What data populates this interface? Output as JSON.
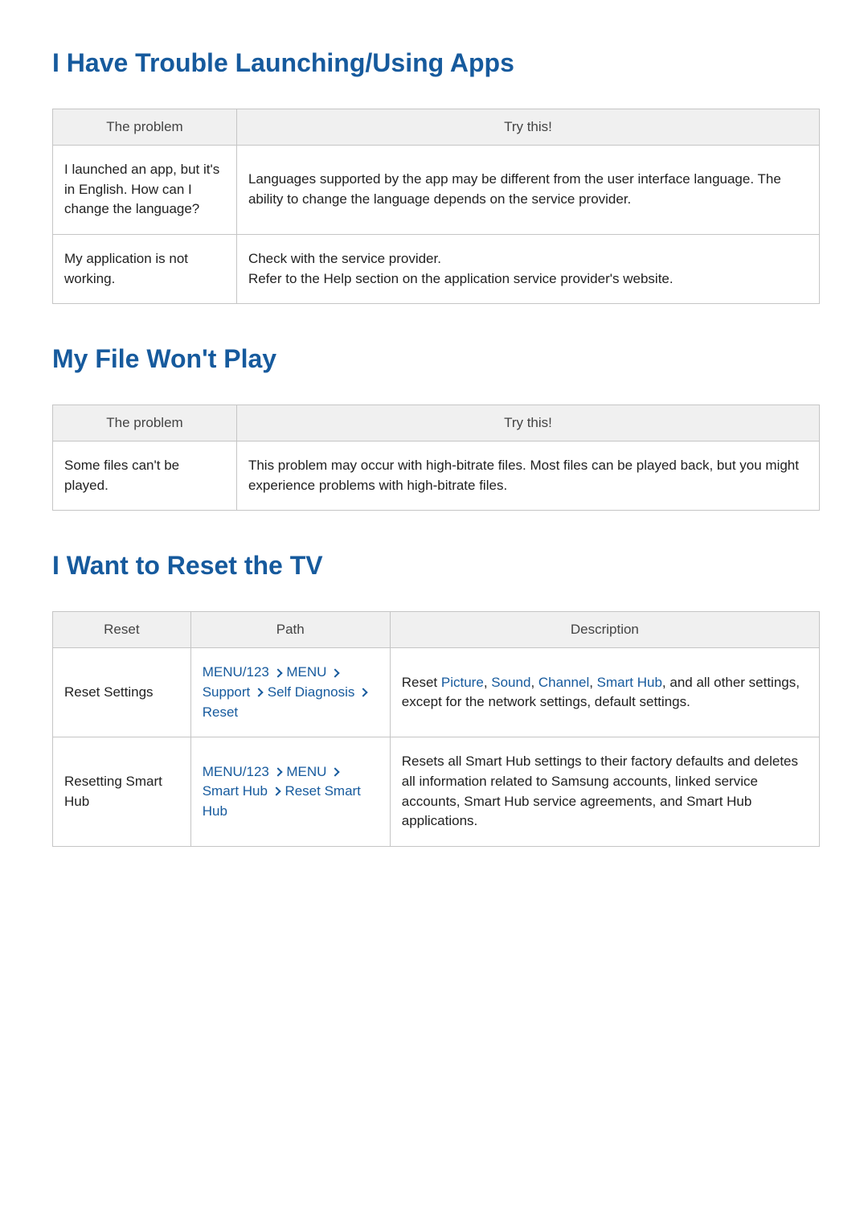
{
  "section1": {
    "heading": "I Have Trouble Launching/Using Apps",
    "headers": {
      "problem": "The problem",
      "solution": "Try this!"
    },
    "rows": [
      {
        "problem": "I launched an app, but it's in English. How can I change the language?",
        "solution": "Languages supported by the app may be different from the user interface language. The ability to change the language depends on the service provider."
      },
      {
        "problem": "My application is not working.",
        "solution": "Check with the service provider.\nRefer to the Help section on the application service provider's website."
      }
    ]
  },
  "section2": {
    "heading": "My File Won't Play",
    "headers": {
      "problem": "The problem",
      "solution": "Try this!"
    },
    "rows": [
      {
        "problem": "Some files can't be played.",
        "solution": "This problem may occur with high-bitrate files. Most files can be played back, but you might experience problems with high-bitrate files."
      }
    ]
  },
  "section3": {
    "heading": "I Want to Reset the TV",
    "headers": {
      "reset": "Reset",
      "path": "Path",
      "description": "Description"
    },
    "rows": [
      {
        "reset": "Reset Settings",
        "path_tokens": [
          "MENU/123",
          ">",
          "MENU",
          ">",
          "Support",
          ">",
          "Self Diagnosis",
          ">",
          "Reset"
        ],
        "description_prefix": "Reset ",
        "description_highlighted": [
          "Picture",
          "Sound",
          "Channel",
          "Smart Hub"
        ],
        "description_suffix": ", and all other settings, except for the network settings, default settings."
      },
      {
        "reset": "Resetting Smart Hub",
        "path_tokens": [
          "MENU/123",
          ">",
          "MENU",
          ">",
          "Smart Hub",
          ">",
          "Reset Smart Hub"
        ],
        "description": "Resets all Smart Hub settings to their factory defaults and deletes all information related to Samsung accounts, linked service accounts, Smart Hub service agreements, and Smart Hub applications."
      }
    ]
  }
}
